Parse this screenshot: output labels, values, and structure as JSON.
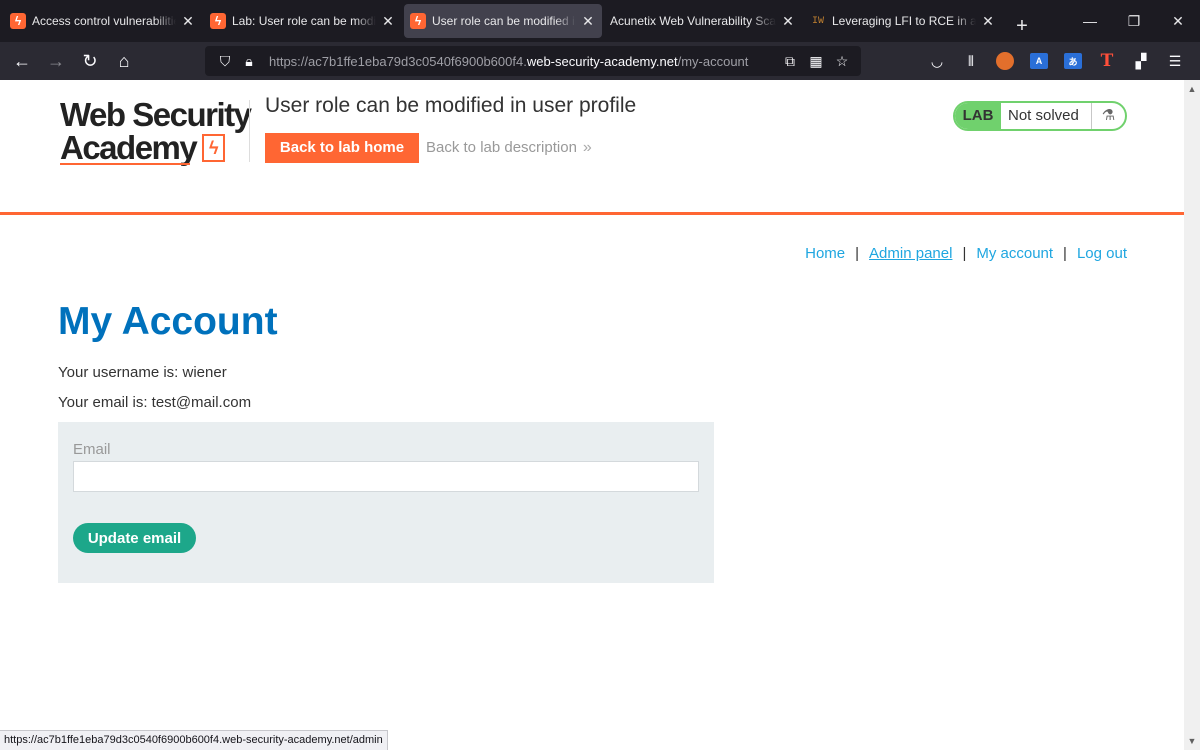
{
  "browser": {
    "tabs": [
      {
        "title": "Access control vulnerabilities",
        "favicon": "wsa",
        "active": false
      },
      {
        "title": "Lab: User role can be modified in user profile",
        "favicon": "wsa",
        "active": false
      },
      {
        "title": "User role can be modified in user profile",
        "favicon": "wsa",
        "active": true
      },
      {
        "title": "Acunetix Web Vulnerability Scanner",
        "favicon": "none",
        "active": false
      },
      {
        "title": "Leveraging LFI to RCE in a website",
        "favicon": "iw",
        "active": false
      }
    ],
    "new_tab": "+",
    "window_controls": {
      "minimize": "—",
      "restore": "❐",
      "close": "✕"
    },
    "url": {
      "prefix": "https://ac7b1ffe1eba79d3c0540f6900b600f4.",
      "host": "web-security-academy.net",
      "path": "/my-account"
    },
    "iw_favicon_text": "IW",
    "status_url": "https://ac7b1ffe1eba79d3c0540f6900b600f4.web-security-academy.net/admin"
  },
  "header": {
    "logo_line1": "Web Security",
    "logo_line2": "Academy",
    "lab_title": "User role can be modified in user profile",
    "back_home": "Back to lab home",
    "back_description": "Back to lab description",
    "back_description_chevron": "»",
    "badge_lab": "LAB",
    "badge_status": "Not solved",
    "badge_icon": "⚗"
  },
  "nav": {
    "home": "Home",
    "admin": "Admin panel",
    "account": "My account",
    "logout": "Log out",
    "separator": "|"
  },
  "main": {
    "heading": "My Account",
    "username_line": "Your username is: wiener",
    "email_line": "Your email is: test@mail.com",
    "form": {
      "email_label": "Email",
      "email_value": "",
      "update_button": "Update email"
    }
  },
  "colors": {
    "accent": "#ff6633",
    "heading": "#0071bc",
    "link": "#1fa6e0",
    "lab_badge": "#70d16d",
    "button": "#1da78a"
  }
}
